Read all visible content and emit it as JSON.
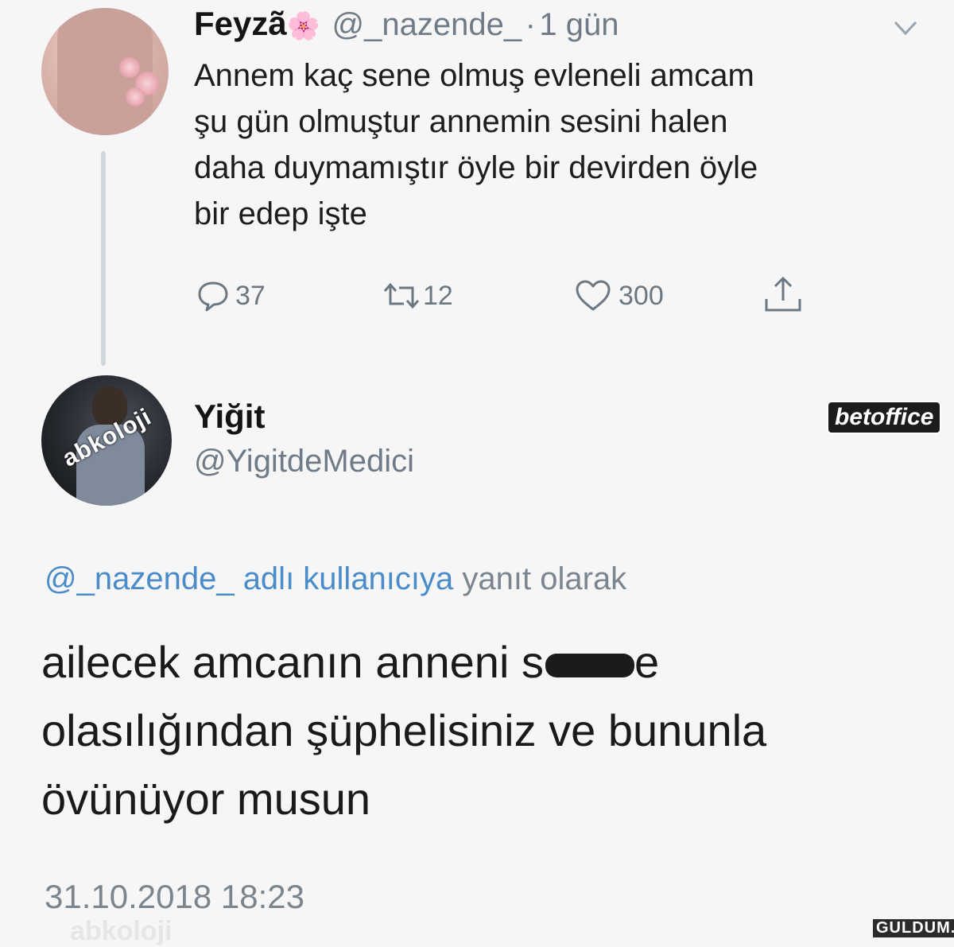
{
  "tweet1": {
    "display_name": "Feyzã",
    "name_emoji": "🌸",
    "handle": "@_nazende_",
    "separator": "·",
    "time_ago": "1 gün",
    "text_lines": [
      "Annem kaç sene olmuş evleneli amcam",
      "şu gün olmuştur annemin sesini halen",
      "daha duymamıştır öyle bir devirden öyle",
      "bir edep işte"
    ],
    "reply_count": "37",
    "retweet_count": "12",
    "like_count": "300"
  },
  "tweet2": {
    "avatar_watermark": "abkoloji",
    "display_name": "Yiğit",
    "handle": "@YigitdeMedici",
    "reply_mention": "@_nazende_ adlı kullanıcıya",
    "reply_suffix": "yanıt olarak",
    "text_line1_visible": "ailecek amcanın anneni s",
    "text_line1_tail": "e",
    "text_lines_rest": [
      "olasılığından şüphelisiniz ve bununla",
      "övünüyor musun"
    ],
    "timestamp": "31.10.2018 18:23",
    "bottom_watermark": "abkoloji"
  },
  "watermarks": {
    "betoffice": "betoffice",
    "guldum": "GULDUM.NET"
  },
  "colors": {
    "background": "#f6f6f6",
    "mention_blue": "#4a8cc9",
    "secondary_gray": "#6f7b86"
  },
  "icons": [
    "chevron-down-icon",
    "reply-icon",
    "retweet-icon",
    "like-icon",
    "share-icon"
  ]
}
